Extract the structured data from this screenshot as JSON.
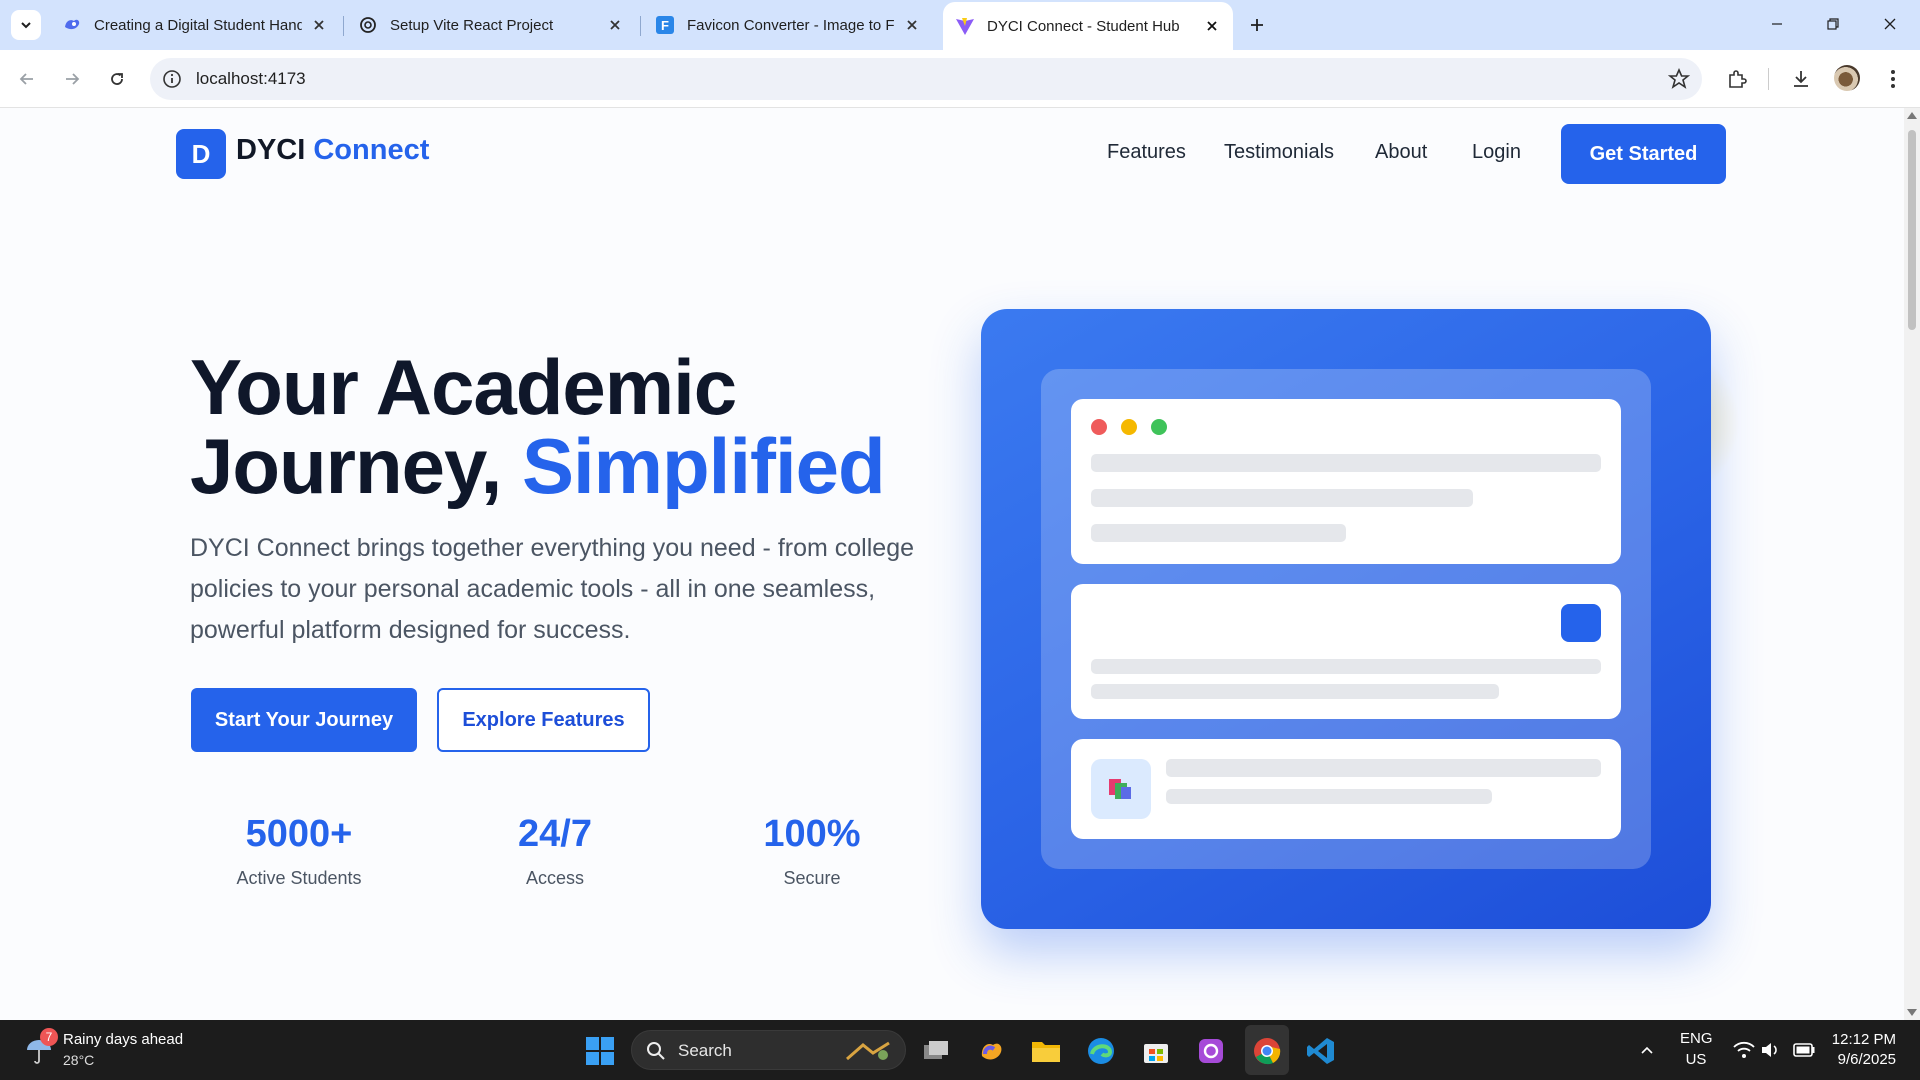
{
  "browser": {
    "tabs": [
      {
        "title": "Creating a Digital Student Hand",
        "favicon": "copilot-icon",
        "active": false
      },
      {
        "title": "Setup Vite React Project",
        "favicon": "openai-icon",
        "active": false
      },
      {
        "title": "Favicon Converter - Image to Fa",
        "favicon": "favicon-converter-icon",
        "active": false
      },
      {
        "title": "DYCI Connect - Student Hub",
        "favicon": "vite-icon",
        "active": true
      }
    ],
    "url": "localhost:4173"
  },
  "page": {
    "logo_letter": "D",
    "logo_name": "DYCI",
    "logo_accent": "Connect",
    "nav": [
      "Features",
      "Testimonials",
      "About",
      "Login"
    ],
    "cta": "Get Started",
    "hero_line1": "Your Academic",
    "hero_line2_prefix": "Journey,",
    "hero_line2_accent": "Simplified",
    "description": "DYCI Connect brings together everything you need - from college policies to your personal academic tools - all in one seamless, powerful platform designed for success.",
    "primary_button": "Start Your Journey",
    "secondary_button": "Explore Features",
    "stats": [
      {
        "value": "5000+",
        "label": "Active Students"
      },
      {
        "value": "24/7",
        "label": "Access"
      },
      {
        "value": "100%",
        "label": "Secure"
      }
    ],
    "colors": {
      "primary": "#2563eb",
      "heading": "#0f172a",
      "text": "#4b5563"
    }
  },
  "taskbar": {
    "weather_title": "Rainy days ahead",
    "weather_temp": "28°C",
    "weather_badge": "7",
    "search_placeholder": "Search",
    "language": "ENG",
    "region": "US",
    "time": "12:12 PM",
    "date": "9/6/2025"
  }
}
